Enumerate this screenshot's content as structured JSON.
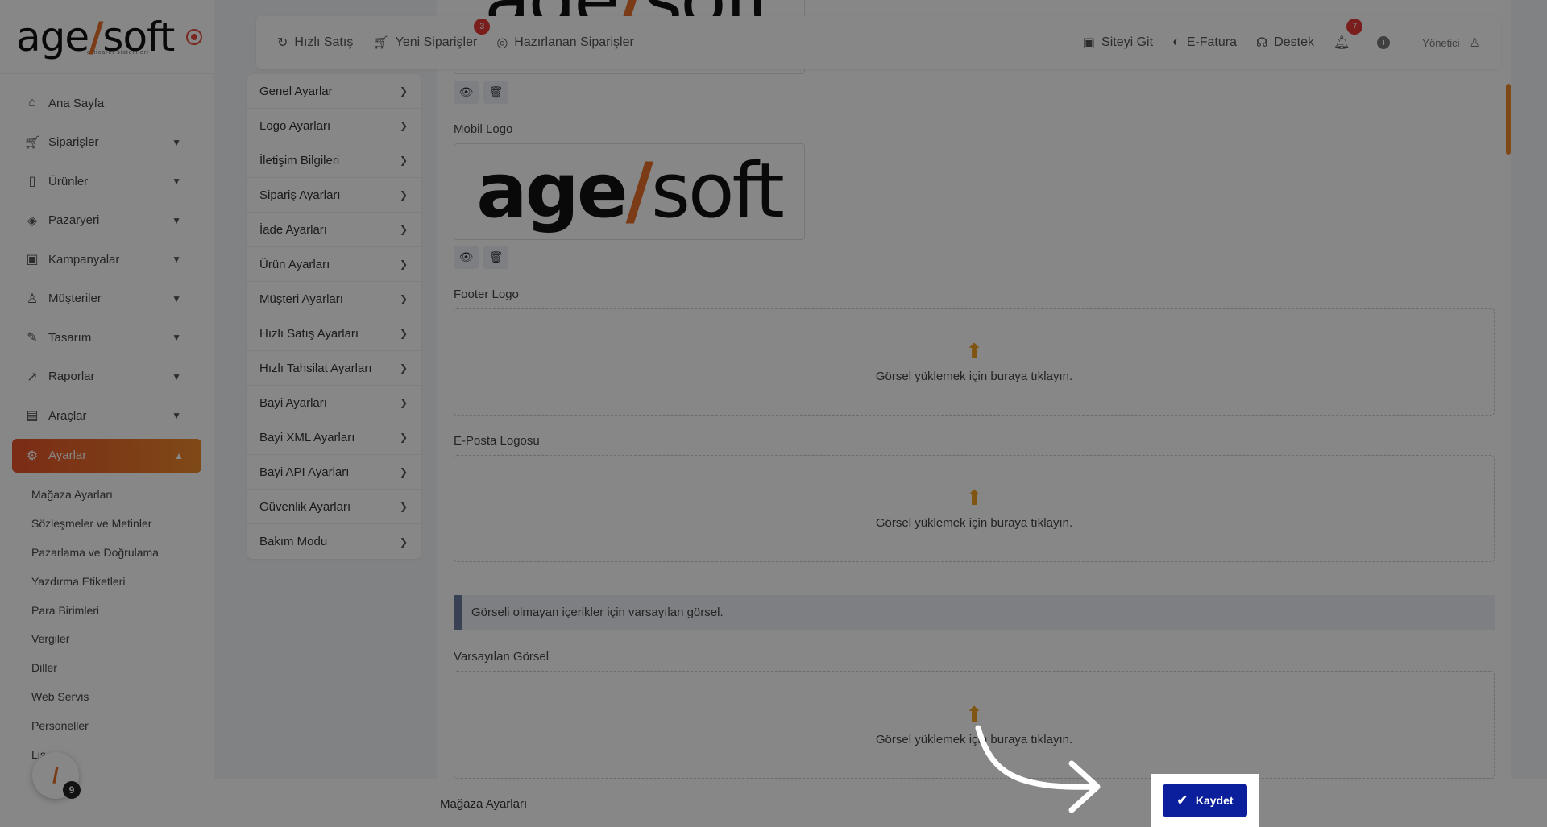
{
  "brand": {
    "name_part1": "age",
    "name_part2": "soft",
    "tagline": "e-ticaret sistemleri"
  },
  "sidebar": {
    "items": [
      {
        "label": "Ana Sayfa",
        "icon": "home-icon"
      },
      {
        "label": "Siparişler",
        "icon": "cart-icon"
      },
      {
        "label": "Ürünler",
        "icon": "book-icon"
      },
      {
        "label": "Pazaryeri",
        "icon": "box-icon"
      },
      {
        "label": "Kampanyalar",
        "icon": "gift-icon"
      },
      {
        "label": "Müşteriler",
        "icon": "user-icon"
      },
      {
        "label": "Tasarım",
        "icon": "edit-icon"
      },
      {
        "label": "Raporlar",
        "icon": "chart-icon"
      },
      {
        "label": "Araçlar",
        "icon": "clipboard-icon"
      },
      {
        "label": "Ayarlar",
        "icon": "gear-icon"
      }
    ],
    "submenu": [
      "Mağaza Ayarları",
      "Sözleşmeler ve Metinler",
      "Pazarlama ve Doğrulama",
      "Yazdırma Etiketleri",
      "Para Birimleri",
      "Vergiler",
      "Diller",
      "Web Servis",
      "Personeller",
      "Lis"
    ],
    "bottom_badge_count": "9"
  },
  "topbar": {
    "quick_sale": "Hızlı Satış",
    "new_orders": "Yeni Siparişler",
    "new_orders_badge": "3",
    "preparing_orders": "Hazırlanan Siparişler",
    "go_site": "Siteyi Git",
    "e_invoice": "E-Fatura",
    "support": "Destek",
    "notifications_badge": "7",
    "info": "i",
    "user": "Yönetici"
  },
  "settings_menu": [
    "Genel Ayarlar",
    "Logo Ayarları",
    "İletişim Bilgileri",
    "Sipariş Ayarları",
    "İade Ayarları",
    "Ürün Ayarları",
    "Müşteri Ayarları",
    "Hızlı Satış Ayarları",
    "Hızlı Tahsilat Ayarları",
    "Bayi Ayarları",
    "Bayi XML Ayarları",
    "Bayi API Ayarları",
    "Güvenlik Ayarları",
    "Bakım Modu"
  ],
  "main": {
    "mobile_logo_label": "Mobil Logo",
    "footer_logo_label": "Footer Logo",
    "email_logo_label": "E-Posta Logosu",
    "default_image_label": "Varsayılan Görsel",
    "upload_text": "Görsel yüklemek için buraya tıklayın.",
    "default_image_info": "Görseli olmayan içerikler için varsayılan görsel."
  },
  "footer": {
    "title": "Mağaza Ayarları",
    "save_label": "Kaydet"
  },
  "colors": {
    "accent": "#e8702a",
    "primary_button": "#0b1f9c",
    "badge": "#e53935"
  }
}
